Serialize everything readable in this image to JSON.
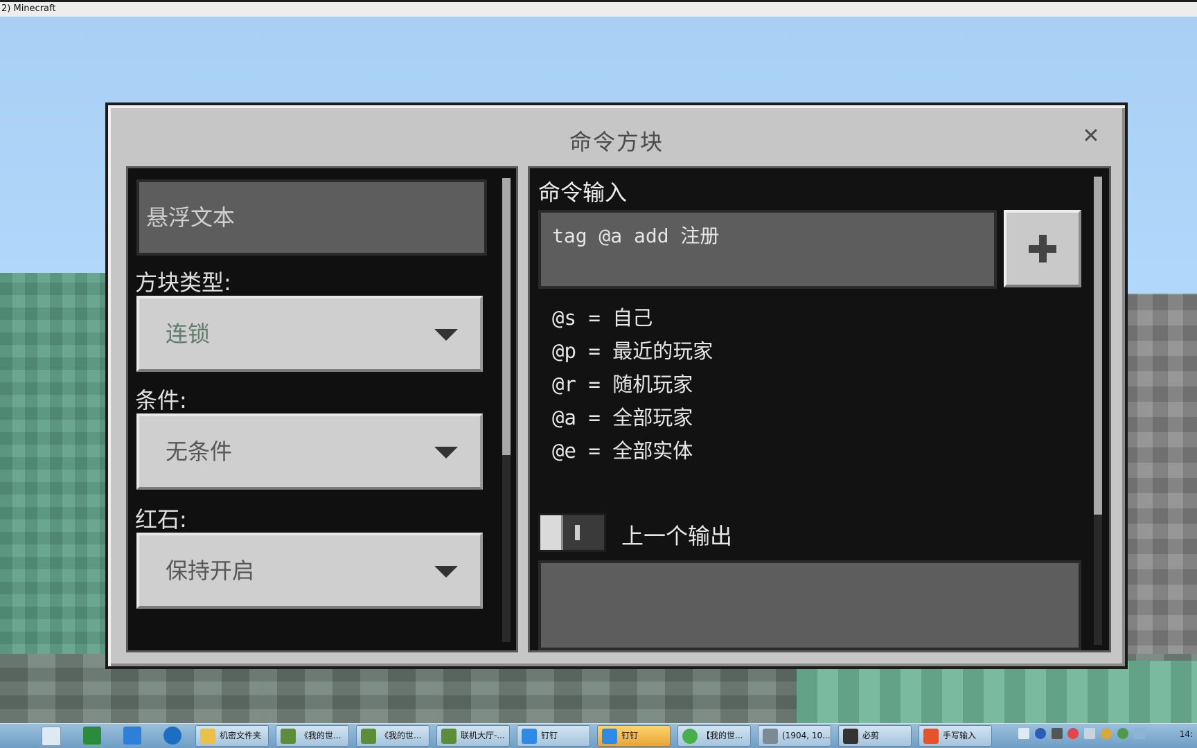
{
  "window": {
    "title": "2) Minecraft"
  },
  "dialog": {
    "title": "命令方块",
    "close_icon": "close-icon"
  },
  "left": {
    "hover_text": "悬浮文本",
    "block_type_label": "方块类型:",
    "block_type_value": "连锁",
    "condition_label": "条件:",
    "condition_value": "无条件",
    "redstone_label": "红石:",
    "redstone_value": "保持开启"
  },
  "right": {
    "command_label": "命令输入",
    "command_value": "tag @a add 注册",
    "add_icon": "plus-icon",
    "selectors": [
      "@s = 自己",
      "@p = 最近的玩家",
      "@r = 随机玩家",
      "@a = 全部玩家",
      "@e = 全部实体"
    ],
    "previous_output_label": "上一个输出",
    "previous_output_toggle": false
  },
  "taskbar": {
    "apps": [
      {
        "label": "机密文件夹",
        "icon": "folder-icon",
        "color": "#e8c04a"
      },
      {
        "label": "《我的世...",
        "icon": "minecraft-grass-icon",
        "color": "#5c8d3a"
      },
      {
        "label": "《我的世...",
        "icon": "minecraft-grass-icon",
        "color": "#5c8d3a"
      },
      {
        "label": "联机大厅-...",
        "icon": "minecraft-grass-icon",
        "color": "#5c8d3a"
      },
      {
        "label": "钉钉",
        "icon": "dingtalk-icon",
        "color": "#2e8ae6"
      },
      {
        "label": "钉钉",
        "icon": "dingtalk-icon",
        "color": "#2e8ae6"
      },
      {
        "label": "【我的世...",
        "icon": "browser-icon",
        "color": "#47b04b"
      },
      {
        "label": "(1904, 10...",
        "icon": "window-icon",
        "color": "#7c8a96"
      },
      {
        "label": "必剪",
        "icon": "bijian-icon",
        "color": "#333333"
      },
      {
        "label": "手写输入",
        "icon": "sogou-icon",
        "color": "#e5532d"
      }
    ],
    "clock": "14:"
  }
}
